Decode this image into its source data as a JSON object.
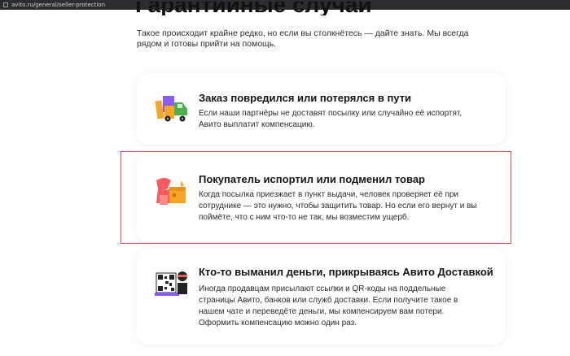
{
  "browser": {
    "url": "avito.ru/general/seller-protection"
  },
  "page": {
    "title": "Гарантийные случаи",
    "intro": "Такое происходит крайне редко, но если вы столкнётесь — дайте знать. Мы всегда рядом и готовы прийти на помощь."
  },
  "cases": [
    {
      "title": "Заказ повредился или потерялся в пути",
      "text": "Если наши партнёры не доставят посылку или случайно её испортят, Авито выплатит компенсацию.",
      "illustration": "delivery-truck-icon"
    },
    {
      "title": "Покупатель испортил или подменил товар",
      "text": "Когда посылка приезжает в пункт выдачи, человек проверяет её при сотруднике — это нужно, чтобы защитить товар. Но если его вернут и вы поймёте, что с ним что-то не так, мы возместим ущерб.",
      "illustration": "damaged-parcel-icon"
    },
    {
      "title": "Кто-то выманил деньги, прикрываясь Авито Доставкой",
      "text": "Иногда продавцам присылают ссылки и QR-коды на поддельные страницы Авито, банков или служб доставки. Если получите такое в нашем чате и переведёте деньги, мы компенсируем вам потери. Оформить компенсацию можно один раз.",
      "illustration": "qr-fraud-icon"
    }
  ],
  "colors": {
    "highlight_border": "#e3474f",
    "accent_orange": "#f5a623",
    "accent_purple": "#8a5cf6",
    "accent_red": "#ff5a5f",
    "accent_green": "#4caf50"
  }
}
